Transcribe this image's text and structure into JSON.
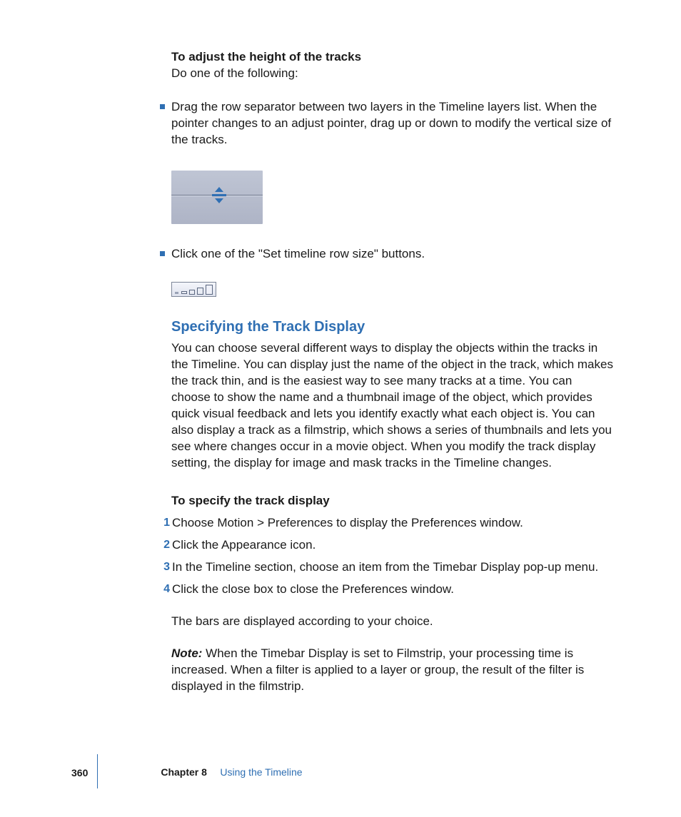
{
  "section1": {
    "heading": "To adjust the height of the tracks",
    "lead": "Do one of the following:",
    "bullets": [
      "Drag the row separator between two layers in the Timeline layers list. When the pointer changes to an adjust pointer, drag up or down to modify the vertical size of the tracks.",
      "Click one of the \"Set timeline row size\" buttons."
    ]
  },
  "section2": {
    "title": "Specifying the Track Display",
    "body": "You can choose several different ways to display the objects within the tracks in the Timeline. You can display just the name of the object in the track, which makes the track thin, and is the easiest way to see many tracks at a time. You can choose to show the name and a thumbnail image of the object, which provides quick visual feedback and lets you identify exactly what each object is. You can also display a track as a filmstrip, which shows a series of thumbnails and lets you see where changes occur in a movie object. When you modify the track display setting, the display for image and mask tracks in the Timeline changes.",
    "proc_heading": "To specify the track display",
    "steps": [
      "Choose Motion > Preferences to display the Preferences window.",
      "Click the Appearance icon.",
      "In the Timeline section, choose an item from the Timebar Display pop-up menu.",
      "Click the close box to close the Preferences window."
    ],
    "step_numbers": [
      "1",
      "2",
      "3",
      "4"
    ],
    "result": "The bars are displayed according to your choice.",
    "note_label": "Note:",
    "note_body": " When the Timebar Display is set to Filmstrip, your processing time is increased. When a filter is applied to a layer or group, the result of the filter is displayed in the filmstrip."
  },
  "footer": {
    "page": "360",
    "chapter_label": "Chapter 8",
    "chapter_title": "Using the Timeline"
  }
}
